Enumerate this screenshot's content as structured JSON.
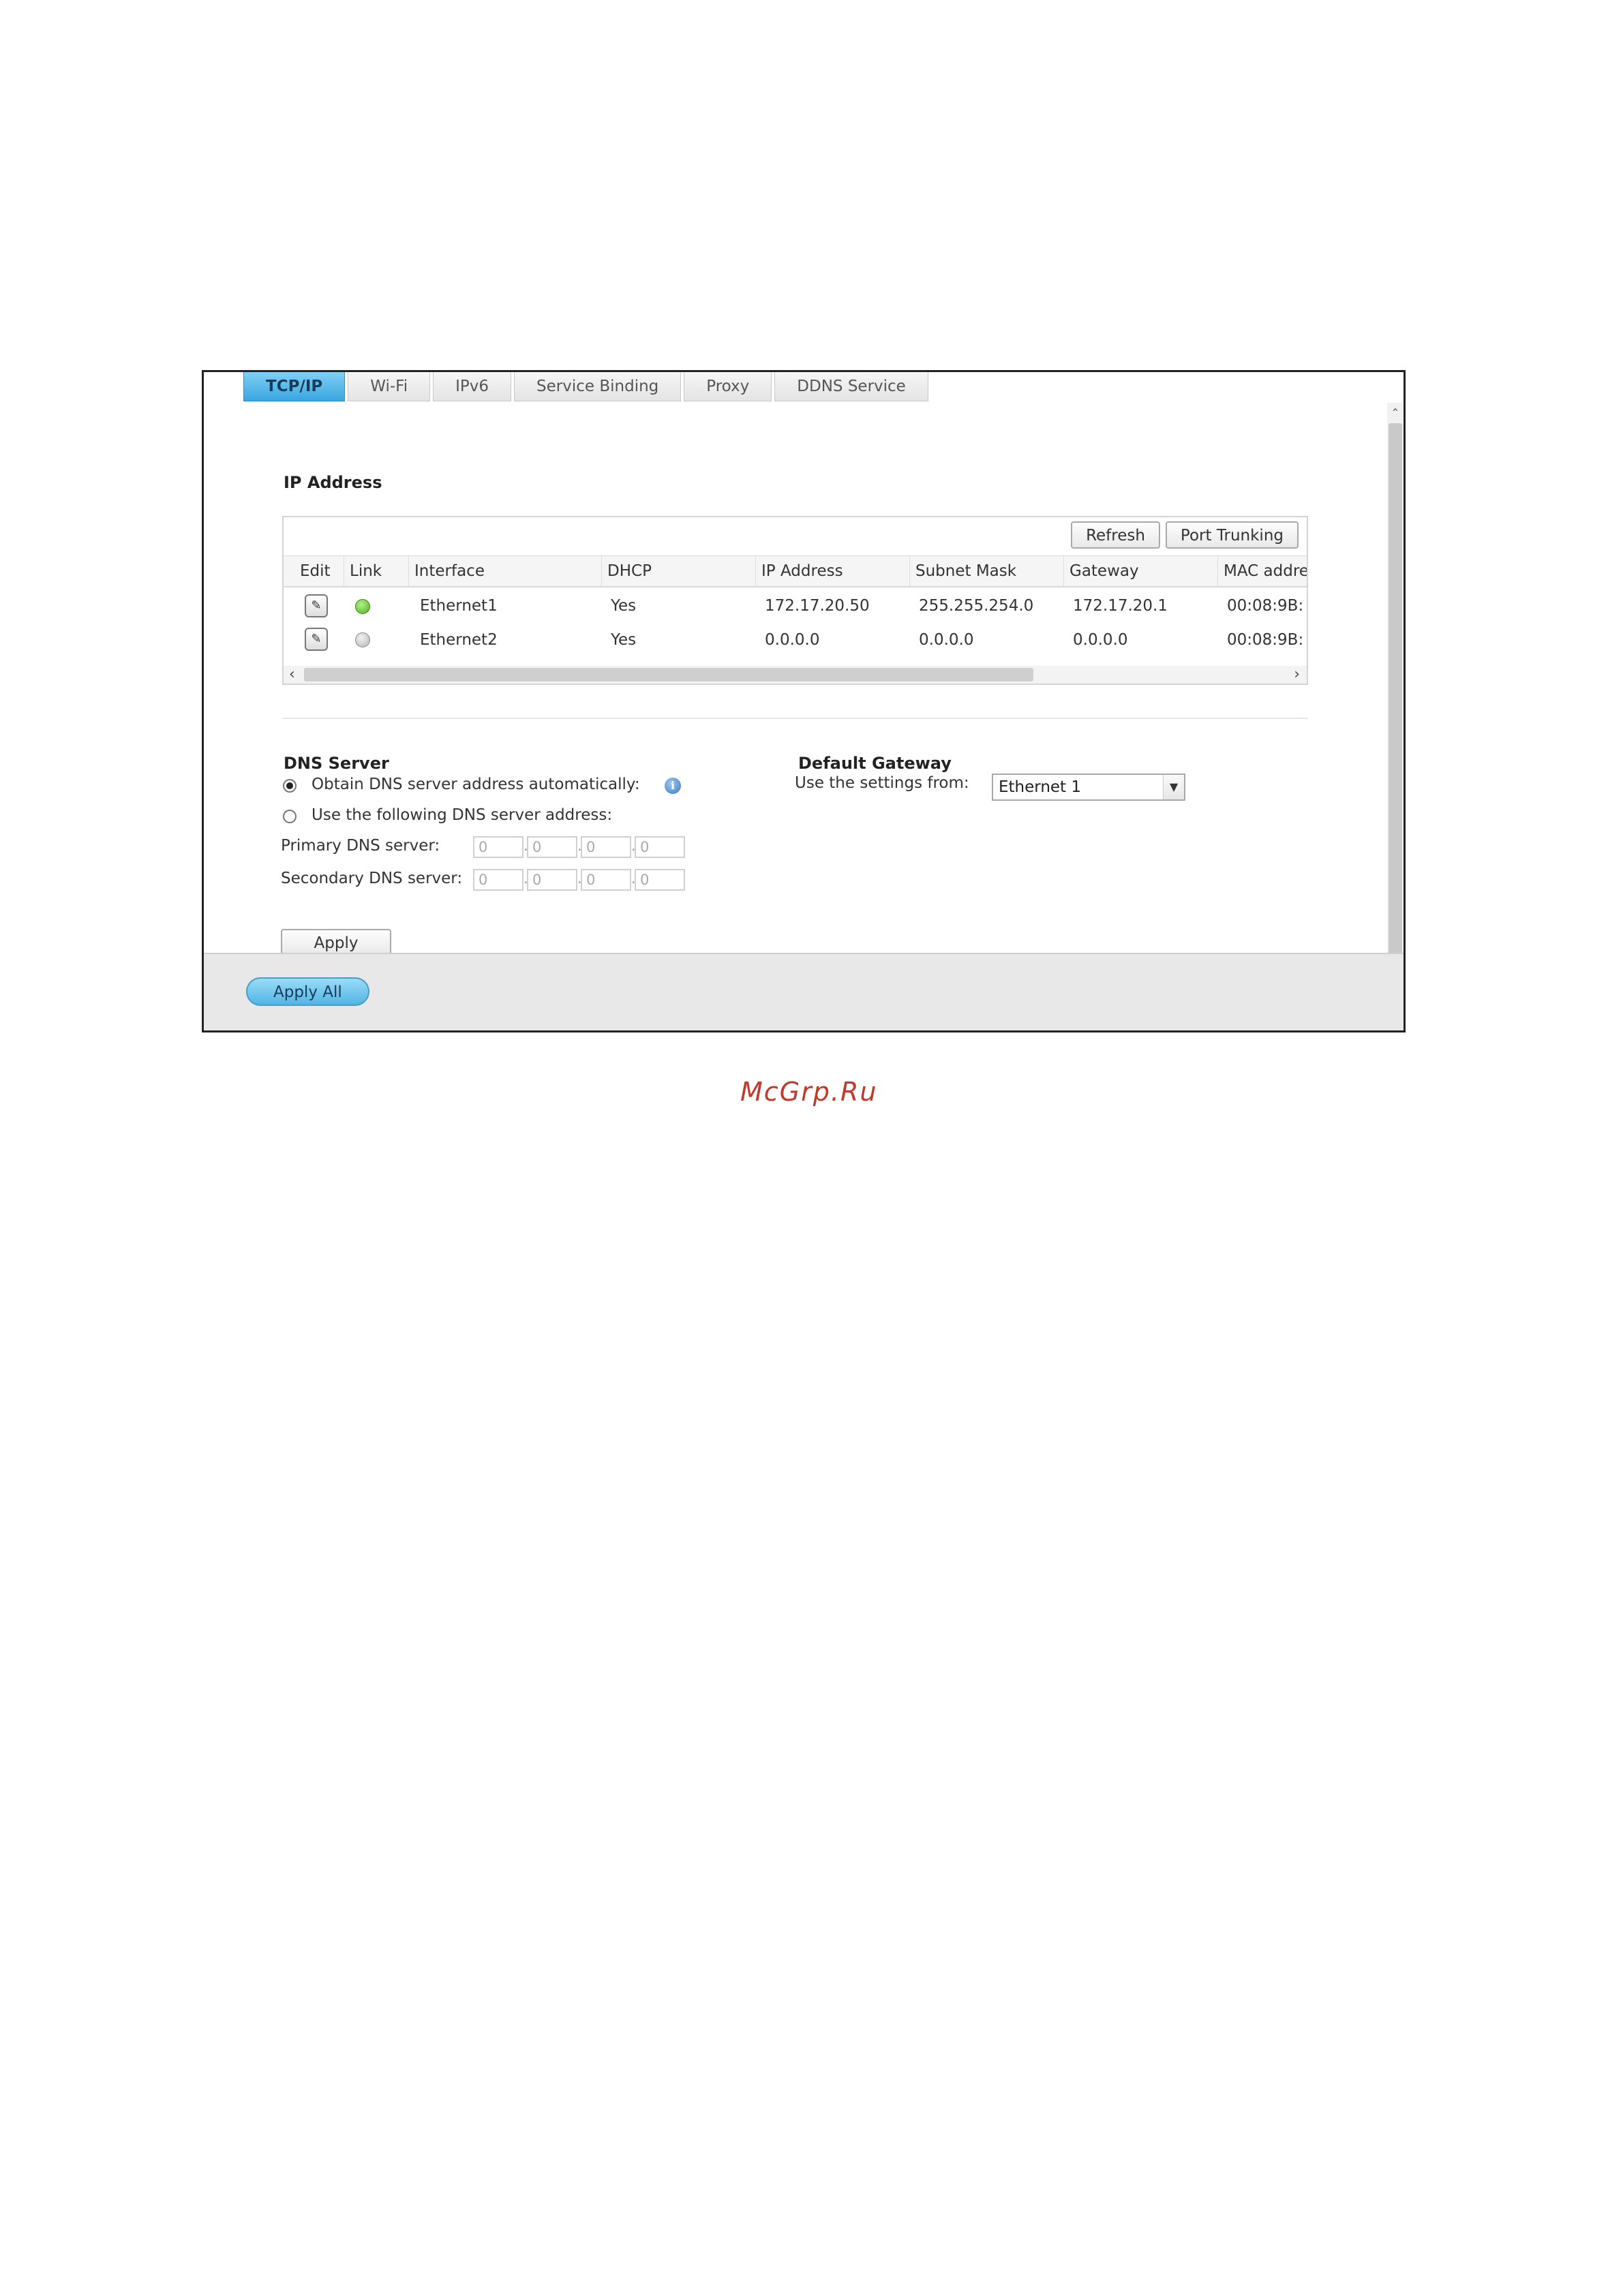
{
  "tabs": [
    "TCP/IP",
    "Wi-Fi",
    "IPv6",
    "Service Binding",
    "Proxy",
    "DDNS Service"
  ],
  "active_tab": "TCP/IP",
  "ip_section": {
    "title": "IP Address",
    "refresh_label": "Refresh",
    "port_trunking_label": "Port Trunking",
    "columns": [
      "Edit",
      "Link",
      "Interface",
      "DHCP",
      "IP Address",
      "Subnet Mask",
      "Gateway",
      "MAC addre"
    ],
    "rows": [
      {
        "link": "up",
        "link_color": "#4caf22",
        "interface": "Ethernet1",
        "dhcp": "Yes",
        "ip": "172.17.20.50",
        "mask": "255.255.254.0",
        "gateway": "172.17.20.1",
        "mac": "00:08:9B:"
      },
      {
        "link": "down",
        "link_color": "#bdbdbd",
        "interface": "Ethernet2",
        "dhcp": "Yes",
        "ip": "0.0.0.0",
        "mask": "0.0.0.0",
        "gateway": "0.0.0.0",
        "mac": "00:08:9B:"
      }
    ]
  },
  "dns": {
    "title": "DNS Server",
    "option_auto": "Obtain DNS server address automatically:",
    "option_manual": "Use the following DNS server address:",
    "primary_label": "Primary DNS server:",
    "secondary_label": "Secondary DNS server:",
    "primary_octets": [
      "0",
      "0",
      "0",
      "0"
    ],
    "secondary_octets": [
      "0",
      "0",
      "0",
      "0"
    ],
    "apply_label": "Apply"
  },
  "gateway": {
    "title": "Default Gateway",
    "use_label": "Use the settings from:",
    "selected": "Ethernet 1"
  },
  "footer": {
    "apply_all_label": "Apply All"
  },
  "watermark": "McGrp.Ru",
  "colors": {
    "accent": "#3aa6df",
    "link_up": "#4caf22",
    "watermark": "#c0392b"
  }
}
